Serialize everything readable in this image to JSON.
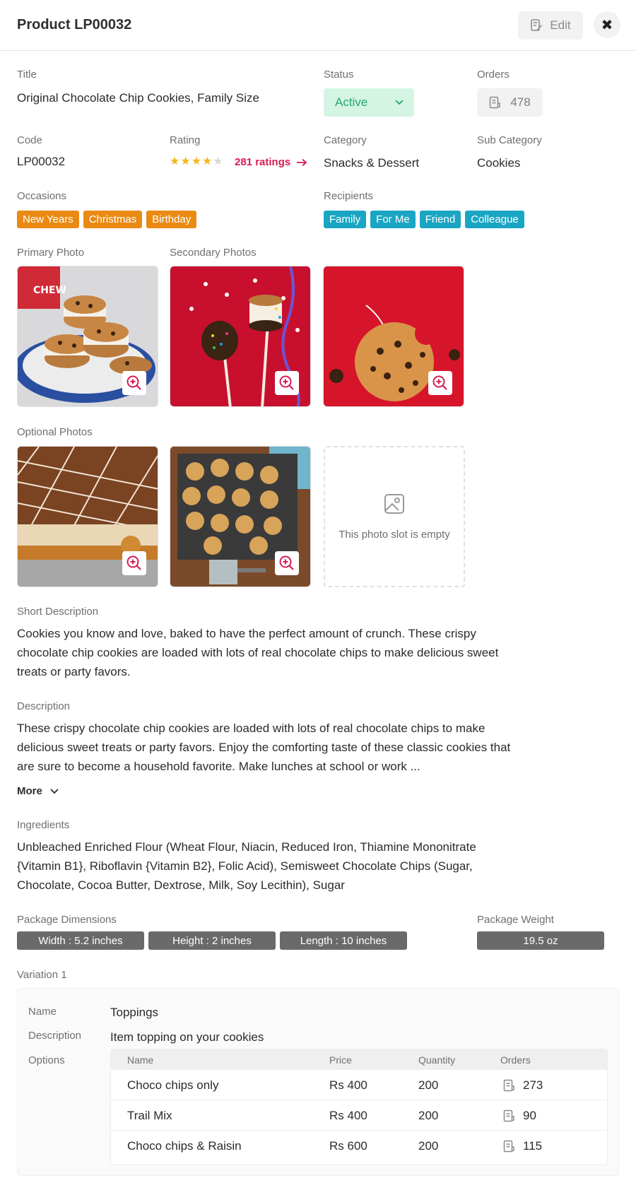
{
  "header": {
    "title": "Product LP00032",
    "edit_label": "Edit"
  },
  "fields": {
    "title_label": "Title",
    "title_value": "Original Chocolate Chip Cookies, Family Size",
    "status_label": "Status",
    "status_value": "Active",
    "orders_label": "Orders",
    "orders_value": "478",
    "code_label": "Code",
    "code_value": "LP00032",
    "rating_label": "Rating",
    "rating_value": 4,
    "rating_max": 5,
    "ratings_link": "281 ratings",
    "category_label": "Category",
    "category_value": "Snacks & Dessert",
    "subcategory_label": "Sub Category",
    "subcategory_value": "Cookies"
  },
  "occasions": {
    "label": "Occasions",
    "items": [
      "New Years",
      "Christmas",
      "Birthday"
    ]
  },
  "recipients": {
    "label": "Recipients",
    "items": [
      "Family",
      "For Me",
      "Friend",
      "Colleague"
    ]
  },
  "photos": {
    "primary_label": "Primary Photo",
    "secondary_label": "Secondary Photos",
    "optional_label": "Optional Photos",
    "empty_slot_text": "This photo slot is empty"
  },
  "short_description": {
    "label": "Short Description",
    "text": "Cookies you know and love, baked to have the perfect amount of crunch. These crispy chocolate chip cookies are loaded with lots of real chocolate chips to make delicious sweet treats or party favors."
  },
  "description": {
    "label": "Description",
    "text": "These crispy chocolate chip cookies are loaded with lots of real chocolate chips to make delicious sweet treats or party favors. Enjoy the comforting taste of these classic cookies that are sure to become a household favorite. Make lunches at school or work ...",
    "more_label": "More"
  },
  "ingredients": {
    "label": "Ingredients",
    "text": "Unbleached Enriched Flour (Wheat Flour, Niacin, Reduced Iron, Thiamine Mononitrate {Vitamin B1}, Riboflavin {Vitamin B2}, Folic Acid), Semisweet Chocolate Chips (Sugar, Chocolate, Cocoa Butter, Dextrose, Milk, Soy Lecithin), Sugar"
  },
  "package": {
    "dimensions_label": "Package Dimensions",
    "width": "Width : 5.2 inches",
    "height": "Height : 2 inches",
    "length": "Length : 10 inches",
    "weight_label": "Package Weight",
    "weight": "19.5 oz"
  },
  "variation": {
    "title": "Variation 1",
    "name_label": "Name",
    "name_value": "Toppings",
    "description_label": "Description",
    "description_value": "Item topping on your cookies",
    "options_label": "Options",
    "columns": [
      "Name",
      "Price",
      "Quantity",
      "Orders"
    ],
    "rows": [
      {
        "name": "Choco chips only",
        "price": "Rs 400",
        "quantity": "200",
        "orders": "273"
      },
      {
        "name": "Trail Mix",
        "price": "Rs 400",
        "quantity": "200",
        "orders": "90"
      },
      {
        "name": "Choco chips & Raisin",
        "price": "Rs 600",
        "quantity": "200",
        "orders": "115"
      }
    ]
  },
  "colors": {
    "accent": "#d61d55",
    "status_active": "#27a56b",
    "occasion_chip": "#ea8a12",
    "recipient_chip": "#1aa6c3",
    "dimension_chip": "#6a6a6a"
  },
  "icons": [
    "edit-icon",
    "close-icon",
    "chevron-down-icon",
    "receipt-icon",
    "star-icon",
    "arrow-right-icon",
    "zoom-in-icon",
    "image-placeholder-icon"
  ]
}
